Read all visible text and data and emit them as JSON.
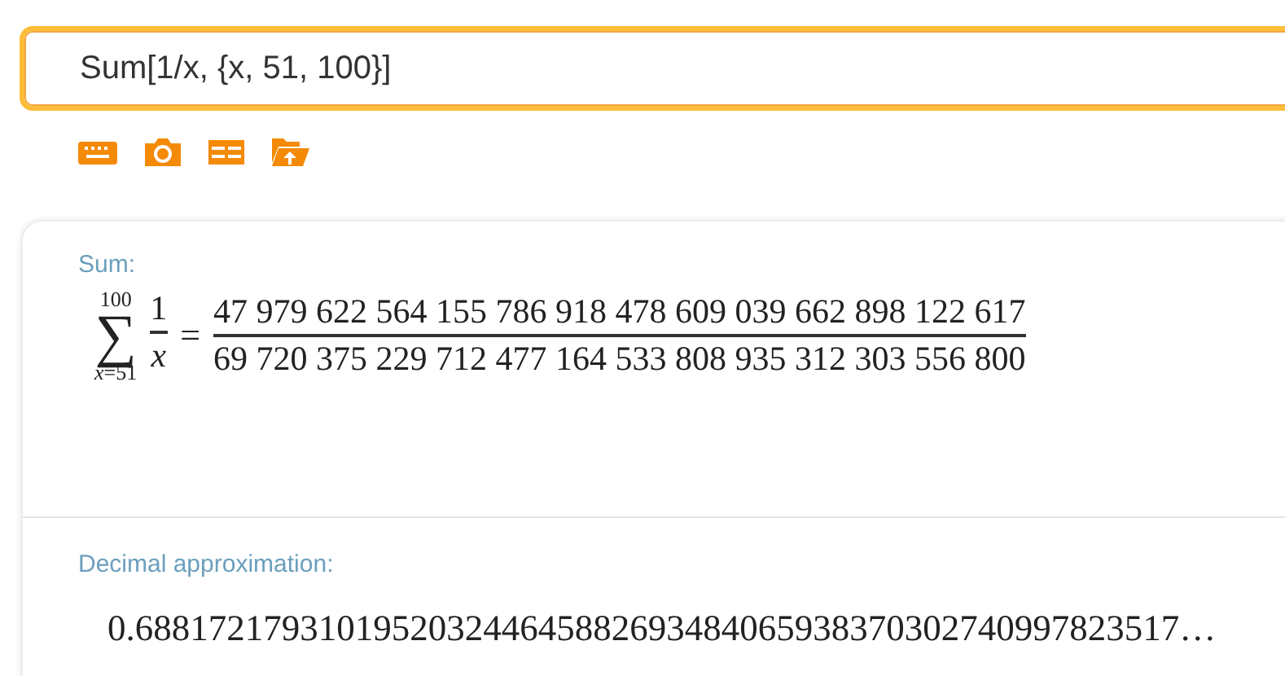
{
  "input": {
    "value": "Sum[1/x, {x, 51, 100}]"
  },
  "pods": [
    {
      "kind": "sum",
      "title": "Sum:",
      "sigma": "∑",
      "upper": "100",
      "lower": "*x*=51",
      "term_numerator": "1",
      "term_denominator": "x",
      "equals": "=",
      "numerator": "47 979 622 564 155 786 918 478 609 039 662 898 122 617",
      "denominator": "69 720 375 229 712 477 164 533 808 935 312 303 556 800"
    },
    {
      "kind": "decimal",
      "title": "Decimal approximation:",
      "value": "0.688172179310195203244645882693484065938370302740997823517…"
    }
  ]
}
